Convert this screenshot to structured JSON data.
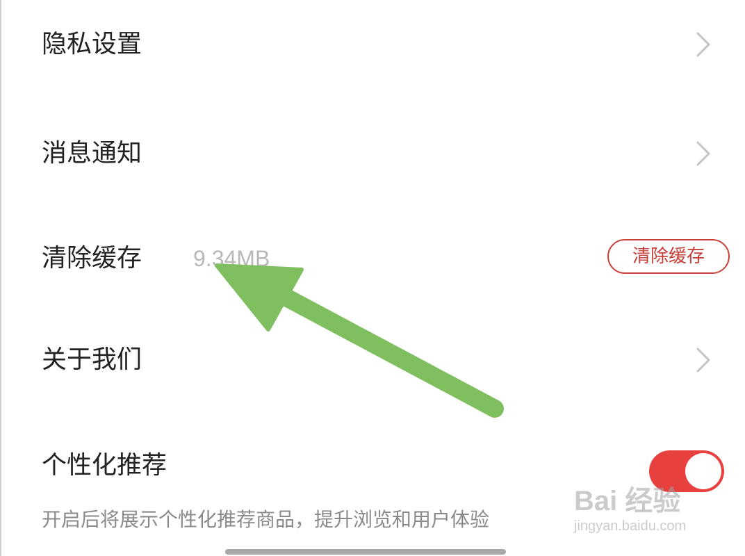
{
  "settings": {
    "items": [
      {
        "label": "隐私设置"
      },
      {
        "label": "消息通知"
      },
      {
        "label": "清除缓存",
        "value": "9.34MB",
        "action_label": "清除缓存"
      },
      {
        "label": "关于我们"
      },
      {
        "label": "个性化推荐",
        "toggle_on": true,
        "description": "开启后将展示个性化推荐商品，提升浏览和用户体验"
      }
    ]
  },
  "watermark": {
    "brand": "Bai 经验",
    "url": "jingyan.baidu.com"
  },
  "colors": {
    "accent_red": "#c8403a",
    "toggle_red": "#e8403f",
    "arrow_green": "#7fbf5f"
  },
  "icons": {
    "chevron": "chevron-right-icon",
    "annotation": "arrow-icon"
  }
}
